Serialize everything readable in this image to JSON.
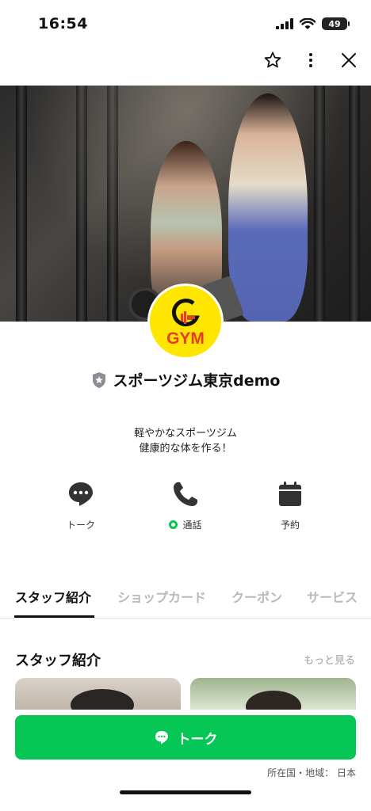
{
  "status_bar": {
    "time": "16:54",
    "battery": "49"
  },
  "profile": {
    "logo_text": "GYM",
    "name": "スポーツジム東京demo",
    "description_line1": "軽やかなスポーツジム",
    "description_line2": "健康的な体を作る！"
  },
  "actions": [
    {
      "label": "トーク",
      "icon": "chat-bubble-icon"
    },
    {
      "label": "通話",
      "icon": "phone-icon"
    },
    {
      "label": "予約",
      "icon": "calendar-icon"
    }
  ],
  "tabs": [
    "スタッフ紹介",
    "ショップカード",
    "クーポン",
    "サービス"
  ],
  "section": {
    "title": "スタッフ紹介",
    "more": "もっと見る"
  },
  "talk_button": {
    "label": "トーク"
  },
  "region": "所在国・地域： 日本",
  "colors": {
    "accent": "#06c755",
    "logo_bg": "#ffe600",
    "logo_text": "#e63b2e"
  }
}
